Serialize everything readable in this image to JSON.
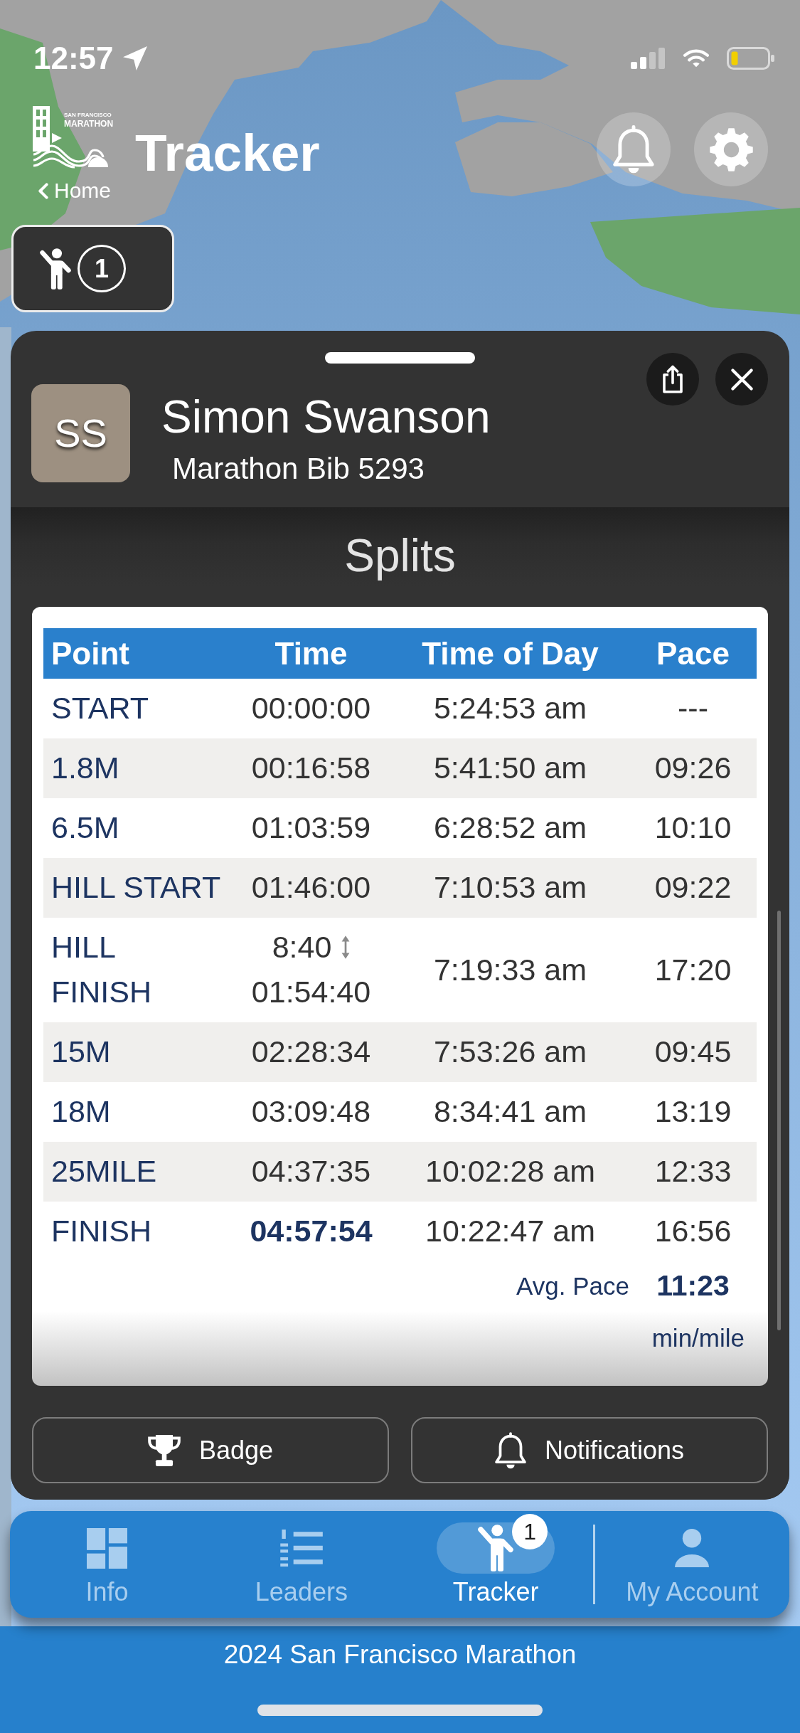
{
  "status_bar": {
    "time": "12:57"
  },
  "header": {
    "logo": {
      "line_1": "SAN FRANCISCO",
      "line_2": "MARATHON"
    },
    "title": "Tracker",
    "back_link": "Home"
  },
  "tracked_runners": {
    "count": "1"
  },
  "runner": {
    "initials": "SS",
    "name": "Simon Swanson",
    "bib": "Marathon Bib 5293"
  },
  "splits": {
    "title": "Splits",
    "columns": [
      "Point",
      "Time",
      "Time of Day",
      "Pace"
    ],
    "rows": [
      {
        "point": "START",
        "time": "00:00:00",
        "time_of_day": "5:24:53 am",
        "pace": "---",
        "final": false
      },
      {
        "point": "1.8M",
        "time": "00:16:58",
        "time_of_day": "5:41:50 am",
        "pace": "09:26",
        "final": false
      },
      {
        "point": "6.5M",
        "time": "01:03:59",
        "time_of_day": "6:28:52 am",
        "pace": "10:10",
        "final": false
      },
      {
        "point": "HILL START",
        "time": "01:46:00",
        "time_of_day": "7:10:53 am",
        "pace": "09:22",
        "final": false
      },
      {
        "point": "HILL FINISH",
        "segment_time": "8:40",
        "time": "01:54:40",
        "time_of_day": "7:19:33 am",
        "pace": "17:20",
        "final": false
      },
      {
        "point": "15M",
        "time": "02:28:34",
        "time_of_day": "7:53:26 am",
        "pace": "09:45",
        "final": false
      },
      {
        "point": "18M",
        "time": "03:09:48",
        "time_of_day": "8:34:41 am",
        "pace": "13:19",
        "final": false
      },
      {
        "point": "25MILE",
        "time": "04:37:35",
        "time_of_day": "10:02:28 am",
        "pace": "12:33",
        "final": false
      },
      {
        "point": "FINISH",
        "time": "04:57:54",
        "time_of_day": "10:22:47 am",
        "pace": "16:56",
        "final": true
      }
    ],
    "avg_pace_label": "Avg. Pace",
    "avg_pace": "11:23",
    "avg_pace_unit": "min/mile"
  },
  "actions": [
    {
      "kind": "badge",
      "label": "Badge"
    },
    {
      "kind": "notifications",
      "label": "Notifications"
    }
  ],
  "tab_bar": [
    {
      "kind": "info",
      "label": "Info",
      "selected": false
    },
    {
      "kind": "leaders",
      "label": "Leaders",
      "selected": false
    },
    {
      "kind": "tracker",
      "label": "Tracker",
      "selected": true,
      "badge": "1"
    },
    {
      "kind": "account",
      "label": "My Account",
      "selected": false
    }
  ],
  "footer": {
    "text": "2024 San Francisco Marathon"
  }
}
